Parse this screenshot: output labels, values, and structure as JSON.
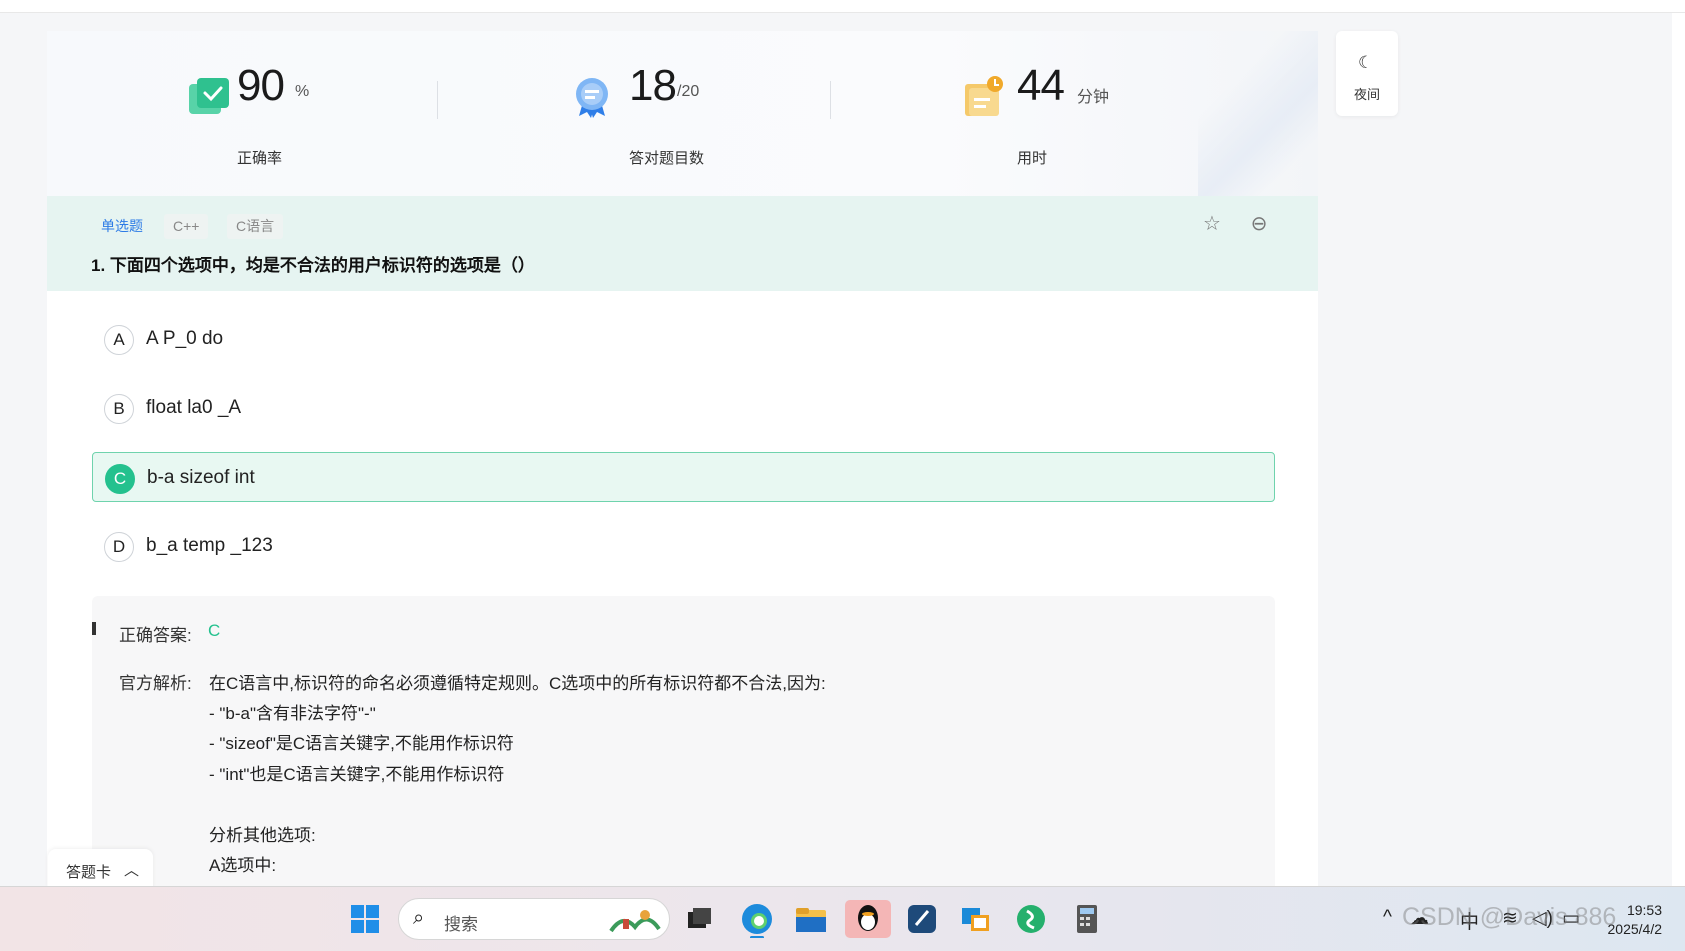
{
  "stats": {
    "accuracy": {
      "value": "90",
      "unit": "%",
      "label": "正确率"
    },
    "correct": {
      "value": "18",
      "unit": "/20",
      "label": "答对题目数"
    },
    "time": {
      "value": "44",
      "unit": "分钟",
      "label": "用时"
    }
  },
  "night_mode": {
    "label": "夜间"
  },
  "question": {
    "tags": [
      "单选题",
      "C++",
      "C语言"
    ],
    "title": "1. 下面四个选项中，均是不合法的用户标识符的选项是（）",
    "selected": "C",
    "options": [
      {
        "letter": "A",
        "text": "A P_0 do"
      },
      {
        "letter": "B",
        "text": "float la0 _A"
      },
      {
        "letter": "C",
        "text": "b-a sizeof int"
      },
      {
        "letter": "D",
        "text": "b_a temp _123"
      }
    ]
  },
  "analysis": {
    "answer_label": "正确答案:",
    "answer_value": "C",
    "explanation_label": "官方解析:",
    "lines": [
      "在C语言中,标识符的命名必须遵循特定规则。C选项中的所有标识符都不合法,因为:",
      "- \"b-a\"含有非法字符\"-\"",
      "- \"sizeof\"是C语言关键字,不能用作标识符",
      "- \"int\"也是C语言关键字,不能用作标识符",
      "",
      "分析其他选项:",
      "A选项中:"
    ]
  },
  "answer_card": {
    "label": "答题卡"
  },
  "taskbar": {
    "search_placeholder": "搜索",
    "ime": "中",
    "time": "19:53",
    "date": "2025/4/2",
    "watermark": "CSDN @Davis 886"
  },
  "colors": {
    "accent_green": "#24c18e",
    "tag_blue": "#2d7be6",
    "header_bg": "#e6f4f1"
  }
}
